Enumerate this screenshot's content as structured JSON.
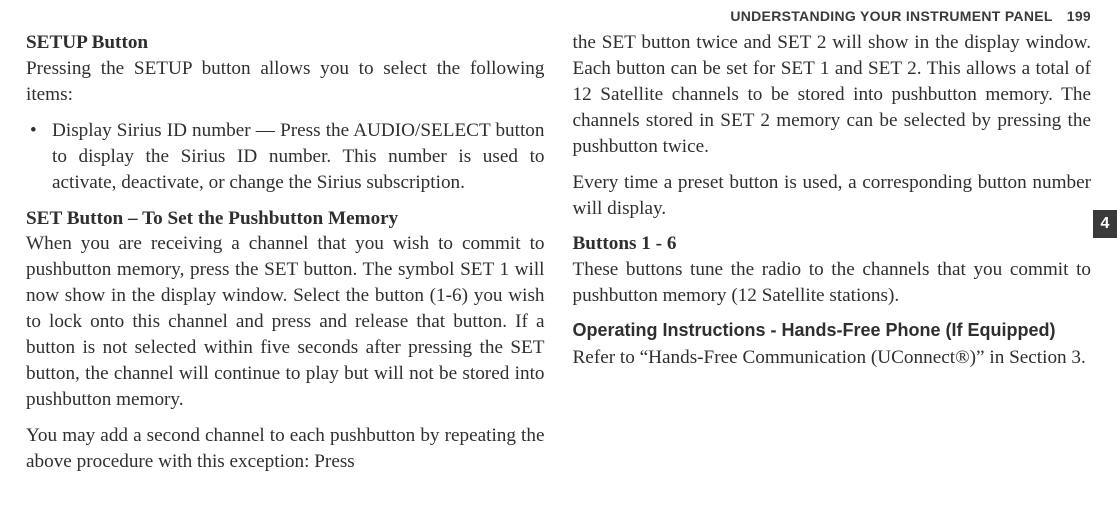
{
  "header": {
    "section": "UNDERSTANDING YOUR INSTRUMENT PANEL",
    "page_number": "199",
    "tab_number": "4"
  },
  "left": {
    "h_setup": "SETUP Button",
    "p_setup": "Pressing the SETUP button allows you to select the following items:",
    "li_sirius": "Display Sirius ID number — Press the AUDIO/SELECT button to display the Sirius ID number. This number is used to activate, deactivate, or change the Sirius subscription.",
    "h_set": "SET Button – To Set the Pushbutton Memory",
    "p_set1": "When you are receiving a channel that you wish to commit to pushbutton memory, press the SET button. The symbol SET 1 will now show in the display window. Select the button (1-6) you wish to lock onto this channel and press and release that button. If a button is not selected within five seconds after pressing the SET button, the channel will continue to play but will not be stored into pushbutton memory.",
    "p_set2": "You may add a second channel to each pushbutton by repeating the above procedure with this exception: Press"
  },
  "right": {
    "p_cont": "the SET button twice and SET 2 will show in the display window. Each button can be set for SET 1 and SET 2. This allows a total of 12 Satellite channels to be stored into pushbutton memory. The channels stored in SET 2 memory can be selected by pressing the pushbutton twice.",
    "p_preset": "Every time a preset button is used, a corresponding button number will display.",
    "h_buttons": "Buttons 1 - 6",
    "p_buttons": "These buttons tune the radio to the channels that you commit to pushbutton memory (12 Satellite stations).",
    "h_hands": "Operating Instructions - Hands-Free Phone (If Equipped)",
    "p_hands": "Refer to “Hands-Free Communication (UConnect®)” in Section 3."
  }
}
